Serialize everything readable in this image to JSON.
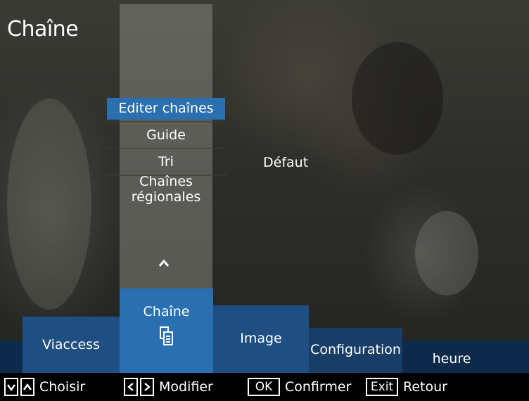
{
  "header": {
    "title": "Chaîne"
  },
  "menu": {
    "items": [
      {
        "label": "Editer chaînes",
        "active": true
      },
      {
        "label": "Guide",
        "active": false
      },
      {
        "label": "Tri",
        "active": false
      },
      {
        "label": "Chaînes régionales",
        "active": false
      }
    ],
    "sort_value": "Défaut"
  },
  "tabs": [
    {
      "label": "Viaccess"
    },
    {
      "label": "Chaîne"
    },
    {
      "label": "Image"
    },
    {
      "label": "Configuration"
    },
    {
      "label": "heure"
    }
  ],
  "help": {
    "choose": "Choisir",
    "modify": "Modifier",
    "ok_key": "OK",
    "confirm": "Confirmer",
    "exit_key": "Exit",
    "back": "Retour"
  },
  "colors": {
    "active_blue": "#2a6fb0",
    "tab_blue": "#1f4f82",
    "bar_navy": "#0d2a4a"
  },
  "icons": [
    "chevron-up-icon",
    "document-icon",
    "arrow-down-key-icon",
    "arrow-up-key-icon",
    "arrow-left-key-icon",
    "arrow-right-key-icon"
  ]
}
